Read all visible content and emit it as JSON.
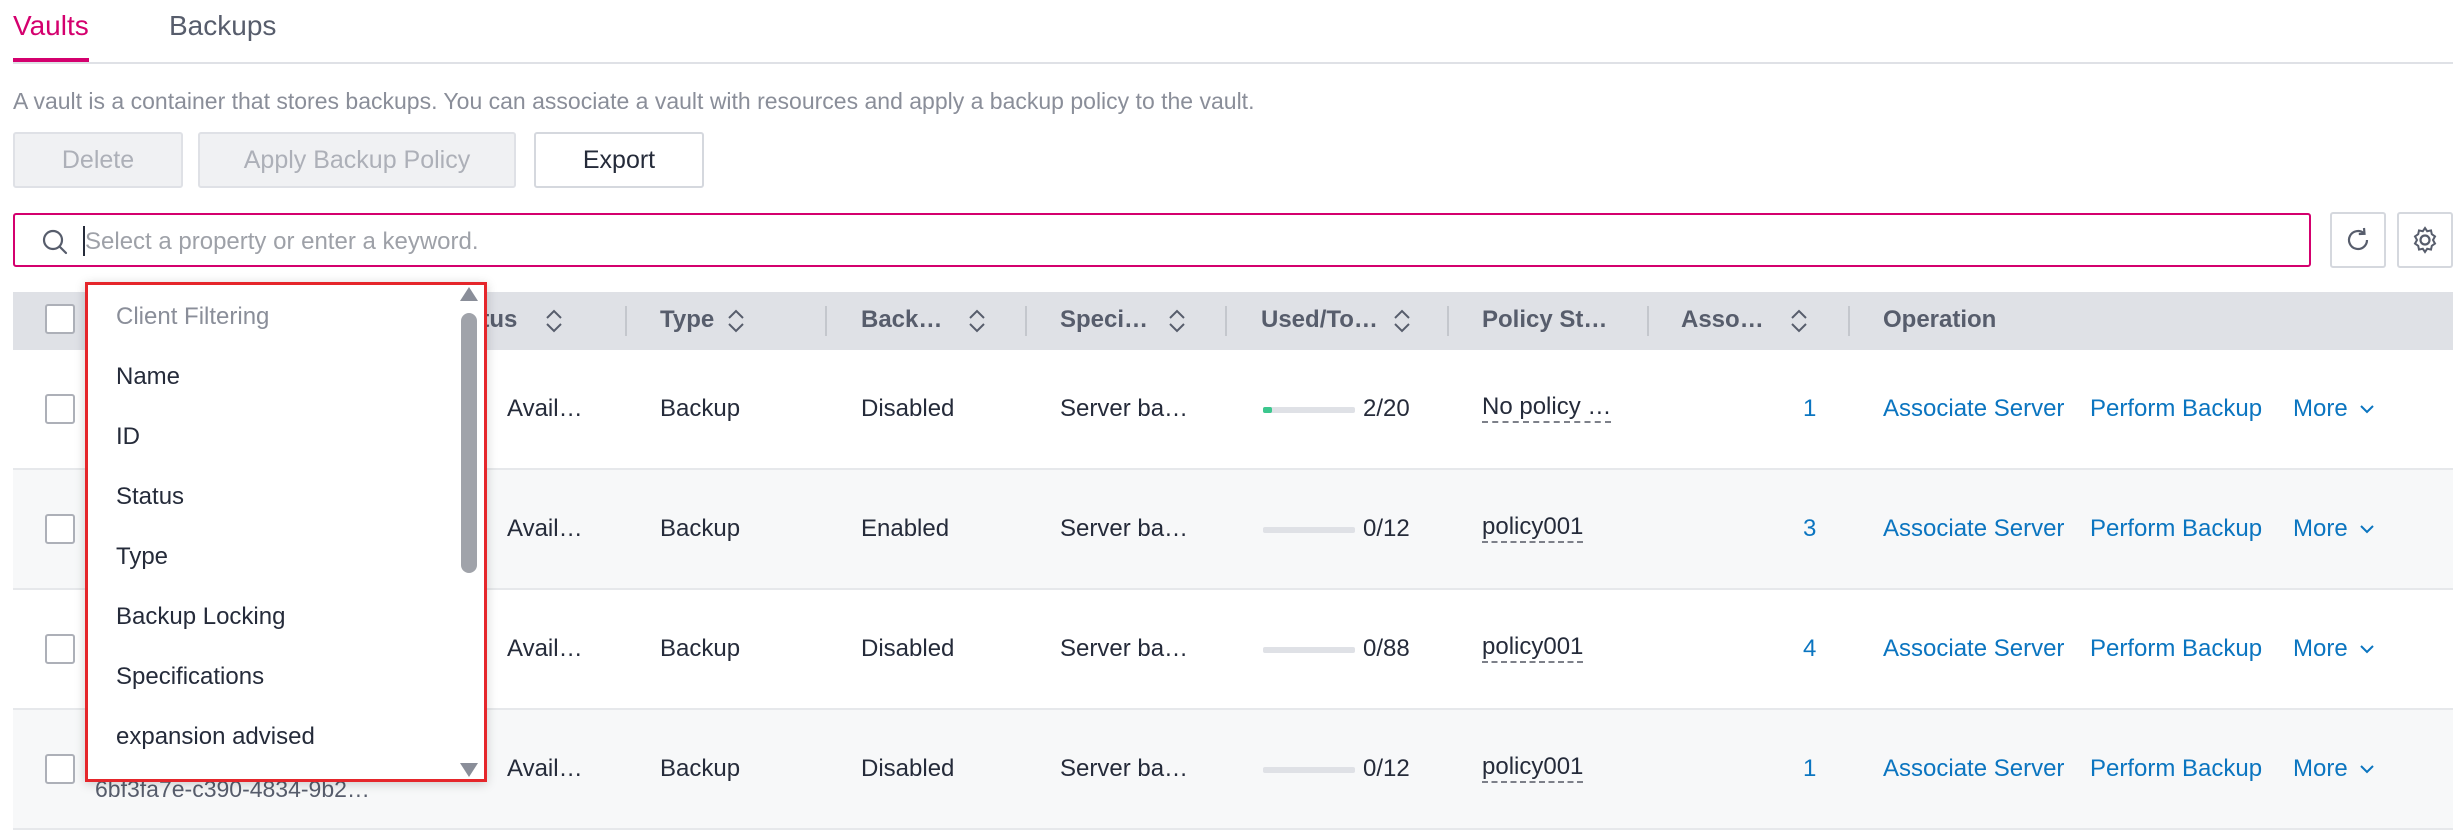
{
  "tabs": [
    {
      "label": "Vaults",
      "active": true
    },
    {
      "label": "Backups",
      "active": false
    }
  ],
  "description": "A vault is a container that stores backups. You can associate a vault with resources and apply a backup policy to the vault.",
  "toolbar": {
    "delete_label": "Delete",
    "apply_policy_label": "Apply Backup Policy",
    "export_label": "Export"
  },
  "search": {
    "placeholder": "Select a property or enter a keyword."
  },
  "table": {
    "headers": [
      "Status",
      "Type",
      "Back…",
      "Speci…",
      "Used/To…",
      "Policy St…",
      "Asso…",
      "Operation"
    ],
    "header_status_visible": "atus",
    "rows": [
      {
        "status": "Avail…",
        "type": "Backup",
        "locking": "Disabled",
        "spec": "Server ba…",
        "used": "2/20",
        "used_fraction": 0.1,
        "policy": "No policy …",
        "assoc": "1",
        "op1": "Associate Server",
        "op2": "Perform Backup",
        "op3": "More"
      },
      {
        "status": "Avail…",
        "type": "Backup",
        "locking": "Enabled",
        "spec": "Server ba…",
        "used": "0/12",
        "used_fraction": 0,
        "policy": "policy001",
        "assoc": "3",
        "op1": "Associate Server",
        "op2": "Perform Backup",
        "op3": "More"
      },
      {
        "status": "Avail…",
        "type": "Backup",
        "locking": "Disabled",
        "spec": "Server ba…",
        "used": "0/88",
        "used_fraction": 0,
        "policy": "policy001",
        "assoc": "4",
        "op1": "Associate Server",
        "op2": "Perform Backup",
        "op3": "More"
      },
      {
        "status": "Avail…",
        "type": "Backup",
        "locking": "Disabled",
        "spec": "Server ba…",
        "used": "0/12",
        "used_fraction": 0,
        "policy": "policy001",
        "assoc": "1",
        "op1": "Associate Server",
        "op2": "Perform Backup",
        "op3": "More"
      }
    ],
    "partial_id_text": "6bf3fa7e-c390-4834-9b2…"
  },
  "dropdown": {
    "header": "Client Filtering",
    "items": [
      "Name",
      "ID",
      "Status",
      "Type",
      "Backup Locking",
      "Specifications",
      "expansion advised"
    ]
  },
  "colors": {
    "accent": "#d4006e",
    "link": "#0b75c0",
    "dropdown_border": "#e5262b",
    "progress": "#3cc78e"
  }
}
